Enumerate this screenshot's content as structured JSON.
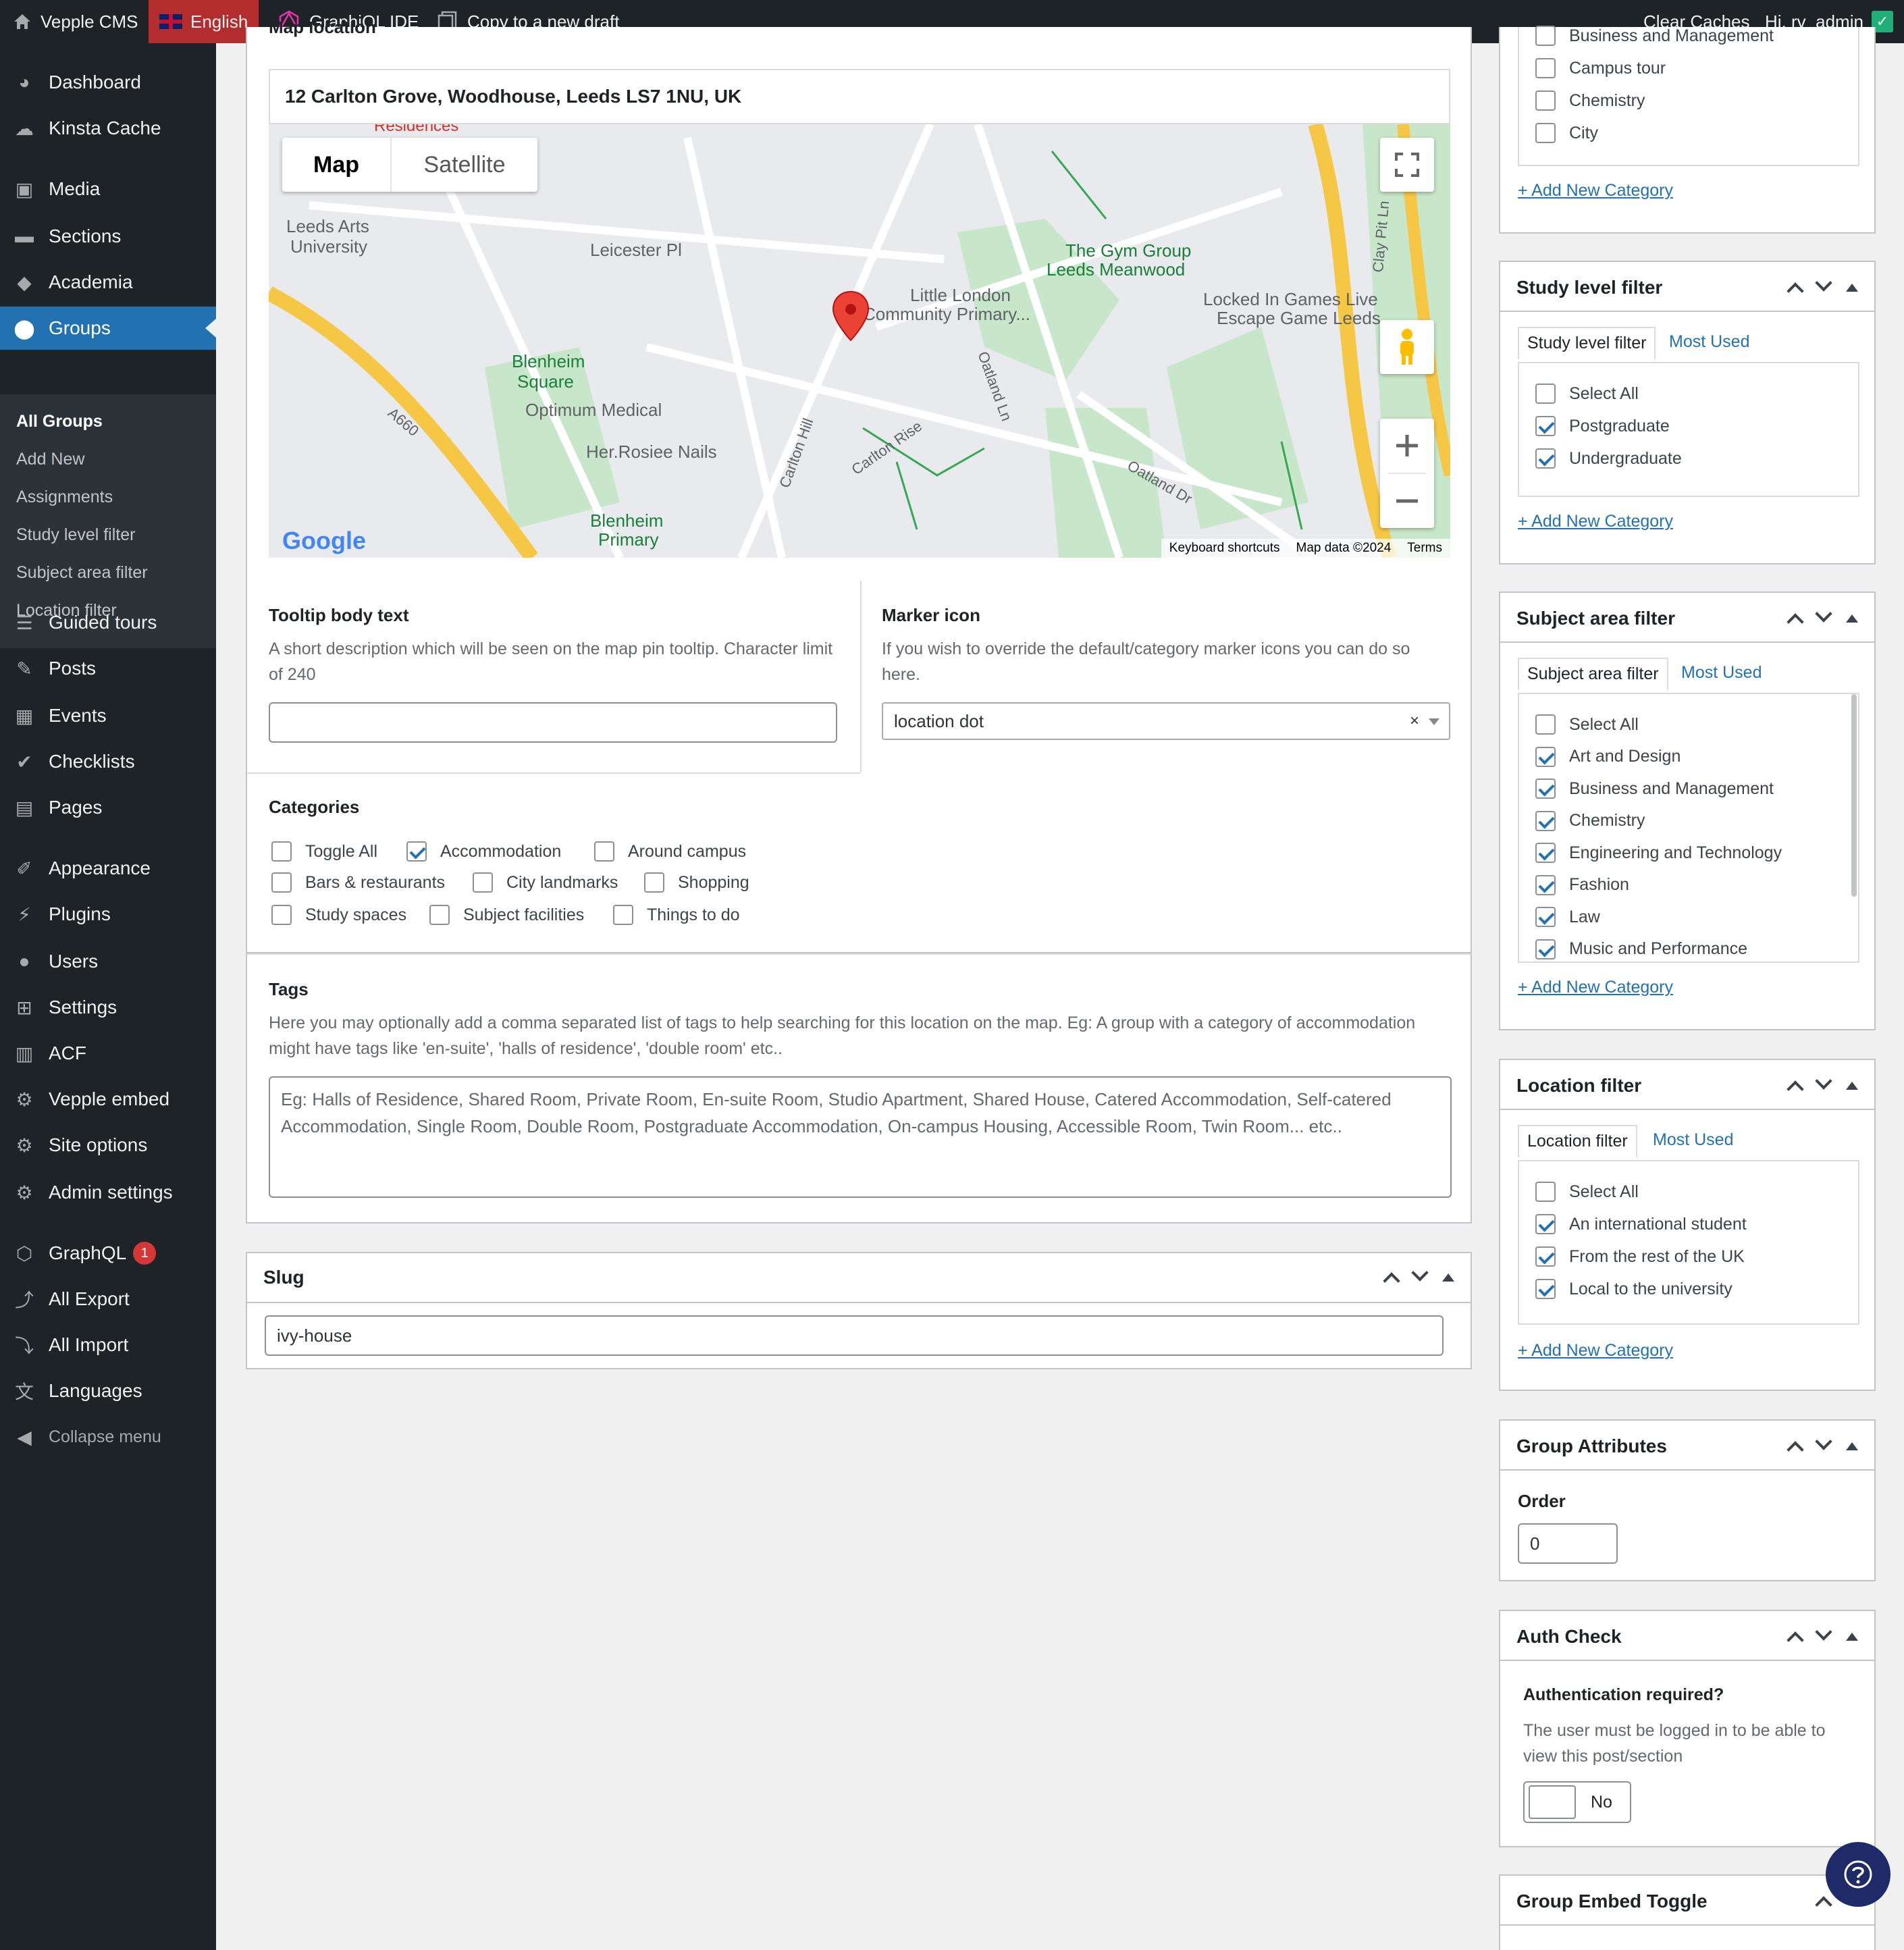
{
  "adminbar": {
    "site_name": "Vepple CMS",
    "language": "English",
    "graphiql": "GraphiQL IDE",
    "copy_draft": "Copy to a new draft",
    "clear_caches": "Clear Caches",
    "greeting": "Hi, rv_admin"
  },
  "sidebar": {
    "items": [
      {
        "label": "Dashboard",
        "icon": "dashboard-icon"
      },
      {
        "label": "Kinsta Cache",
        "icon": "cloud-icon"
      },
      {
        "label": "Media",
        "icon": "media-icon"
      },
      {
        "label": "Sections",
        "icon": "folder-icon"
      },
      {
        "label": "Academia",
        "icon": "graduation-cap-icon"
      },
      {
        "label": "Groups",
        "icon": "location-pin-icon"
      },
      {
        "label": "Guided tours",
        "icon": "list-icon"
      },
      {
        "label": "Posts",
        "icon": "posts-icon"
      },
      {
        "label": "Events",
        "icon": "calendar-icon"
      },
      {
        "label": "Checklists",
        "icon": "check-circle-icon"
      },
      {
        "label": "Pages",
        "icon": "pages-icon"
      },
      {
        "label": "Appearance",
        "icon": "paintbrush-icon"
      },
      {
        "label": "Plugins",
        "icon": "plugin-icon"
      },
      {
        "label": "Users",
        "icon": "user-icon"
      },
      {
        "label": "Settings",
        "icon": "settings-icon"
      },
      {
        "label": "ACF",
        "icon": "acf-icon"
      },
      {
        "label": "Vepple embed",
        "icon": "gear-icon"
      },
      {
        "label": "Site options",
        "icon": "gear-icon"
      },
      {
        "label": "Admin settings",
        "icon": "gear-icon"
      },
      {
        "label": "GraphQL",
        "icon": "graphql-icon",
        "badge": "1"
      },
      {
        "label": "All Export",
        "icon": "export-icon"
      },
      {
        "label": "All Import",
        "icon": "import-icon"
      },
      {
        "label": "Languages",
        "icon": "translate-icon"
      },
      {
        "label": "Collapse menu",
        "icon": "collapse-icon"
      }
    ],
    "submenu": [
      "All Groups",
      "Add New",
      "Assignments",
      "Study level filter",
      "Subject area filter",
      "Location filter"
    ]
  },
  "map": {
    "section_label": "Map location",
    "address": "12 Carlton Grove, Woodhouse, Leeds LS7 1NU, UK",
    "tab_map": "Map",
    "tab_satellite": "Satellite",
    "attribution": [
      "Keyboard shortcuts",
      "Map data ©2024",
      "Terms"
    ],
    "google": "Google",
    "place_labels": [
      "Leeds Arts University",
      "Leicester Pl",
      "Blenheim Square",
      "Optimum Medical",
      "Her.Rosiee Nails",
      "Little London Community Primary...",
      "The Gym Group Leeds Meanwood",
      "Locked In Games Live Escape Game Leeds",
      "Blenheim Primary School",
      "A660",
      "Carlton Hill",
      "Carlton Rise",
      "Oatland Ln",
      "Oatland Dr",
      "Clay Pit Ln",
      "Residences"
    ]
  },
  "tooltip": {
    "label": "Tooltip body text",
    "description": "A short description which will be seen on the map pin tooltip. Character limit of 240",
    "value": ""
  },
  "marker": {
    "label": "Marker icon",
    "description": "If you wish to override the default/category marker icons you can do so here.",
    "value": "location dot",
    "clear": "×"
  },
  "categories": {
    "label": "Categories",
    "items": [
      {
        "label": "Toggle All",
        "checked": false
      },
      {
        "label": "Accommodation",
        "checked": true
      },
      {
        "label": "Around campus",
        "checked": false
      },
      {
        "label": "Bars & restaurants",
        "checked": false
      },
      {
        "label": "City landmarks",
        "checked": false
      },
      {
        "label": "Shopping",
        "checked": false
      },
      {
        "label": "Study spaces",
        "checked": false
      },
      {
        "label": "Subject facilities",
        "checked": false
      },
      {
        "label": "Things to do",
        "checked": false
      }
    ]
  },
  "tags": {
    "label": "Tags",
    "description": "Here you may optionally add a comma separated list of tags to help searching for this location on the map. Eg: A group with a category of accommodation might have tags like 'en-suite', 'halls of residence', 'double room' etc..",
    "placeholder": "Eg: Halls of Residence, Shared Room, Private Room, En-suite Room, Studio Apartment, Shared House, Catered Accommodation, Self-catered Accommodation, Single Room, Double Room, Postgraduate Accommodation, On-campus Housing, Accessible Room, Twin Room... etc.."
  },
  "slug": {
    "title": "Slug",
    "value": "ivy-house"
  },
  "right": {
    "top_categories": [
      "Business and Management",
      "Campus tour",
      "Chemistry",
      "City"
    ],
    "add_new": "+ Add New Category",
    "study_level": {
      "title": "Study level filter",
      "tab_all": "Study level filter",
      "tab_used": "Most Used",
      "items": [
        {
          "label": "Select All",
          "checked": false
        },
        {
          "label": "Postgraduate",
          "checked": true
        },
        {
          "label": "Undergraduate",
          "checked": true
        }
      ]
    },
    "subject_area": {
      "title": "Subject area filter",
      "tab_all": "Subject area filter",
      "tab_used": "Most Used",
      "items": [
        {
          "label": "Select All",
          "checked": false
        },
        {
          "label": "Art and Design",
          "checked": true
        },
        {
          "label": "Business and Management",
          "checked": true
        },
        {
          "label": "Chemistry",
          "checked": true
        },
        {
          "label": "Engineering and Technology",
          "checked": true
        },
        {
          "label": "Fashion",
          "checked": true
        },
        {
          "label": "Law",
          "checked": true
        },
        {
          "label": "Music and Performance",
          "checked": true
        }
      ]
    },
    "location": {
      "title": "Location filter",
      "tab_all": "Location filter",
      "tab_used": "Most Used",
      "items": [
        {
          "label": "Select All",
          "checked": false
        },
        {
          "label": "An international student",
          "checked": true
        },
        {
          "label": "From the rest of the UK",
          "checked": true
        },
        {
          "label": "Local to the university",
          "checked": true
        }
      ]
    },
    "group_attributes": {
      "title": "Group Attributes",
      "order_label": "Order",
      "order_value": "0"
    },
    "auth_check": {
      "title": "Auth Check",
      "question": "Authentication required?",
      "description": "The user must be logged in to be able to view this post/section",
      "toggle_value": "No"
    },
    "group_embed": {
      "title": "Group Embed Toggle"
    }
  },
  "colors": {
    "accent": "#2271b1",
    "adminbar": "#1d2327",
    "lang_bg": "#b32d2e",
    "map_marker": "#ea4335"
  }
}
